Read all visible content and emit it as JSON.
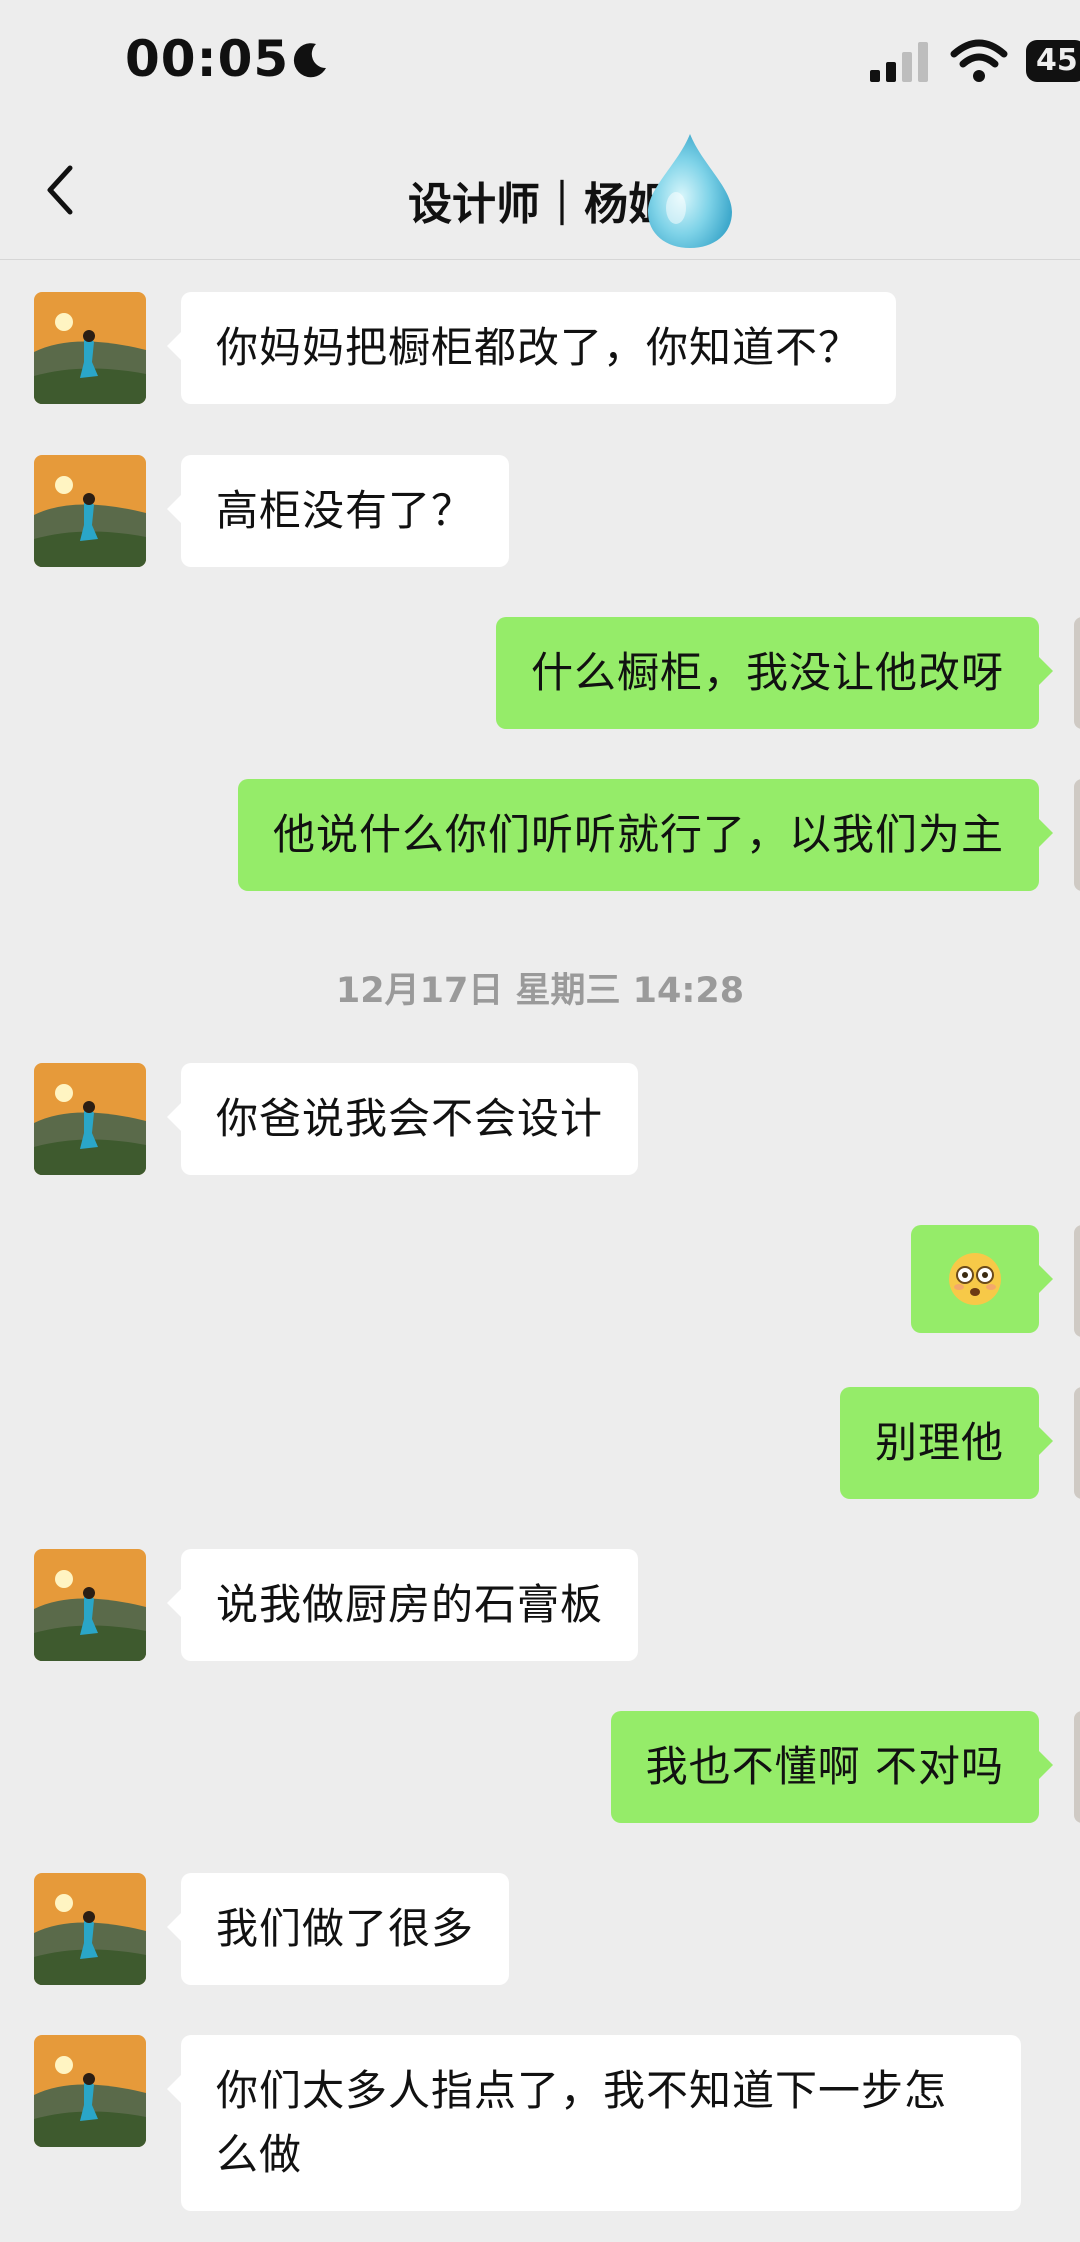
{
  "status_bar": {
    "time": "00:05",
    "battery": "45",
    "icons": [
      "moon-icon",
      "signal-icon",
      "wifi-icon",
      "battery-icon"
    ]
  },
  "nav": {
    "title": "设计师｜杨姐",
    "back_icon": "chevron-left-icon"
  },
  "colors": {
    "background": "#ededed",
    "incoming_bubble": "#ffffff",
    "outgoing_bubble": "#95ec69",
    "timestamp_text": "#9a9a9a"
  },
  "messages": [
    {
      "side": "in",
      "text": "你妈妈把橱柜都改了，你知道不？"
    },
    {
      "side": "in",
      "text": "高柜没有了？"
    },
    {
      "side": "out",
      "text": "什么橱柜，我没让他改呀"
    },
    {
      "side": "out",
      "text": "他说什么你们听听就行了，以我们为主"
    },
    {
      "side": "in",
      "text": "你爸说我会不会设计"
    },
    {
      "side": "out",
      "emoji": "flushed-face-emoji"
    },
    {
      "side": "out",
      "text": "别理他"
    },
    {
      "side": "in",
      "text": "说我做厨房的石膏板"
    },
    {
      "side": "out",
      "text": "我也不懂啊 不对吗"
    },
    {
      "side": "in",
      "text": "我们做了很多"
    },
    {
      "side": "in",
      "text": "你们太多人指点了，我不知道下一步怎么做"
    }
  ],
  "timestamp": "12月17日 星期三 14:28"
}
